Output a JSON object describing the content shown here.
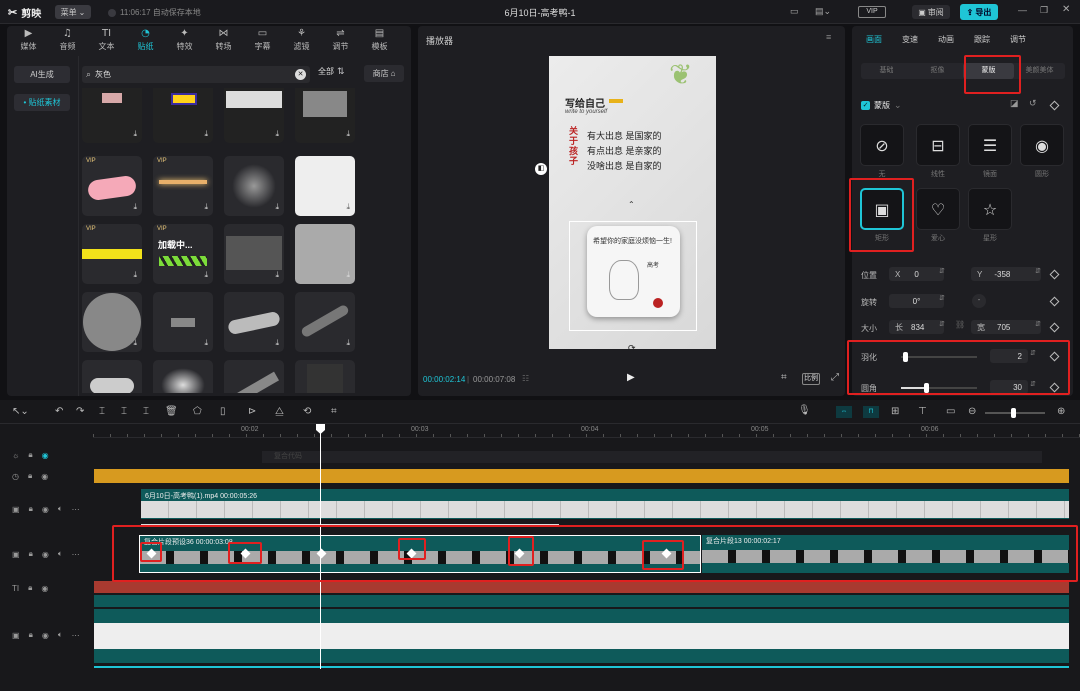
{
  "app": {
    "logo": "剪映",
    "menu_label": "菜单",
    "autosave": "11:06:17 自动保存本地",
    "title": "6月10日-高考鸭-1",
    "vip_label": "VIP",
    "review_label": "审阅",
    "export_label": "导出"
  },
  "media_tabs": [
    {
      "icon": "media-icon",
      "label": "媒体"
    },
    {
      "icon": "audio-icon",
      "label": "音频"
    },
    {
      "icon": "text-icon",
      "label": "文本"
    },
    {
      "icon": "sticker-icon",
      "label": "贴纸"
    },
    {
      "icon": "effects-icon",
      "label": "特效"
    },
    {
      "icon": "transition-icon",
      "label": "转场"
    },
    {
      "icon": "subtitle-icon",
      "label": "字幕"
    },
    {
      "icon": "filter-icon",
      "label": "滤镜"
    },
    {
      "icon": "adjust-icon",
      "label": "调节"
    },
    {
      "icon": "template-icon",
      "label": "模板"
    }
  ],
  "sticker_sidebar": {
    "ai_label": "AI生成",
    "active_label": "• 贴纸素材"
  },
  "sticker_search": {
    "placeholder": "灰色",
    "value": "灰色",
    "filter_label": "全部",
    "store_label": "商店"
  },
  "sticker_tiles": {
    "vip_label": "VIP",
    "loading_label": "加载中...",
    "download_glyph": "⤓"
  },
  "player": {
    "title": "播放器",
    "current_time": "00:00:02:14",
    "total_time": "00:00:07:08",
    "ratio_label": "比例"
  },
  "poster": {
    "heading": "写给自己",
    "subheading": "write to yourself",
    "side_text": "关于孩子",
    "line1": "有大出息 是国家的",
    "line2": "有点出息 是亲家的",
    "line3": "没啥出息 是自家的",
    "card_text": "希望你的家庭没烦恼一生!",
    "card_label": "高考"
  },
  "inspector": {
    "tabs": [
      "画面",
      "变速",
      "动画",
      "跟踪",
      "调节"
    ],
    "subtabs": [
      "基础",
      "抠像",
      "蒙版",
      "美颜美体"
    ],
    "mask_section_label": "蒙版",
    "masks": [
      {
        "label": "无",
        "icon": "none-icon"
      },
      {
        "label": "线性",
        "icon": "linear-mask-icon"
      },
      {
        "label": "镜面",
        "icon": "mirror-mask-icon"
      },
      {
        "label": "圆形",
        "icon": "circle-mask-icon"
      },
      {
        "label": "矩形",
        "icon": "rectangle-mask-icon"
      },
      {
        "label": "爱心",
        "icon": "heart-mask-icon"
      },
      {
        "label": "星形",
        "icon": "star-mask-icon"
      }
    ],
    "position_label": "位置",
    "x_label": "X",
    "x_value": "0",
    "y_label": "Y",
    "y_value": "-358",
    "rotate_label": "旋转",
    "rotate_value": "0°",
    "size_label": "大小",
    "width_label": "长",
    "width_value": "834",
    "height_label": "宽",
    "height_value": "705",
    "feather_label": "羽化",
    "feather_value": "2",
    "feather_fraction": 0.02,
    "radius_label": "圆角",
    "radius_value": "30",
    "radius_fraction": 0.3
  },
  "timeline": {
    "ruler": [
      "00:02",
      "00:03",
      "00:04",
      "00:05",
      "00:06"
    ],
    "compound_placeholder": "复合代码",
    "main_clip_label": "6月10日-高考鸭(1).mp4  00:00:05:26",
    "compound_clip_label": "复合片段预设36  00:00:03:08",
    "compound_clip2_label": "复合片段13  00:00:02:17"
  },
  "colors": {
    "accent": "#1fc5d6",
    "clip_teal": "#0e5a5a",
    "audio_orange": "#d79a1f",
    "text_red": "#a83a30",
    "highlight": "#e02020"
  }
}
